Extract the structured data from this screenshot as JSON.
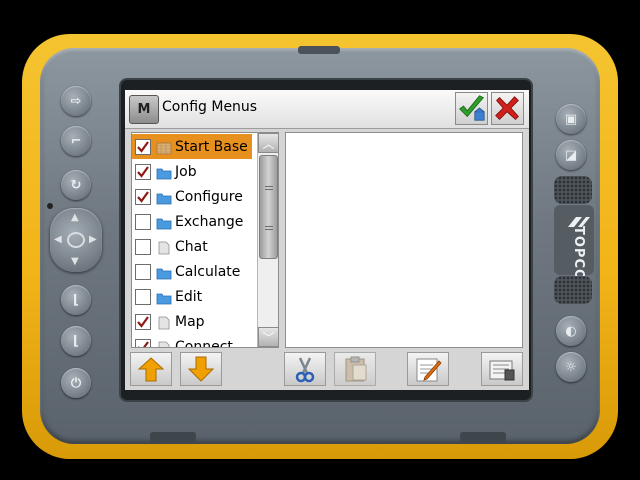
{
  "window": {
    "title": "Config Menus",
    "menu_button_label": "M"
  },
  "menu_list": {
    "items": [
      {
        "label": "Start Base",
        "checked": true,
        "icon": "texture-folder-icon",
        "selected": true
      },
      {
        "label": "Job",
        "checked": true,
        "icon": "folder-icon",
        "selected": false
      },
      {
        "label": "Configure",
        "checked": true,
        "icon": "folder-icon",
        "selected": false
      },
      {
        "label": "Exchange",
        "checked": false,
        "icon": "folder-icon",
        "selected": false
      },
      {
        "label": "Chat",
        "checked": false,
        "icon": "document-icon",
        "selected": false
      },
      {
        "label": "Calculate",
        "checked": false,
        "icon": "folder-icon",
        "selected": false
      },
      {
        "label": "Edit",
        "checked": false,
        "icon": "folder-icon",
        "selected": false
      },
      {
        "label": "Map",
        "checked": true,
        "icon": "document-icon",
        "selected": false
      },
      {
        "label": "Connect",
        "checked": true,
        "icon": "document-icon",
        "selected": false
      }
    ]
  },
  "toolbar": {
    "buttons": [
      "move-up",
      "move-down",
      "cut",
      "paste",
      "edit",
      "properties"
    ]
  },
  "device": {
    "brand": "TOPCON"
  },
  "colors": {
    "selection": "#e8901e",
    "bumper": "#f2b418",
    "ok_green": "#2e9e2a",
    "cancel_red": "#d0201c",
    "arrow_orange": "#f0a000"
  }
}
